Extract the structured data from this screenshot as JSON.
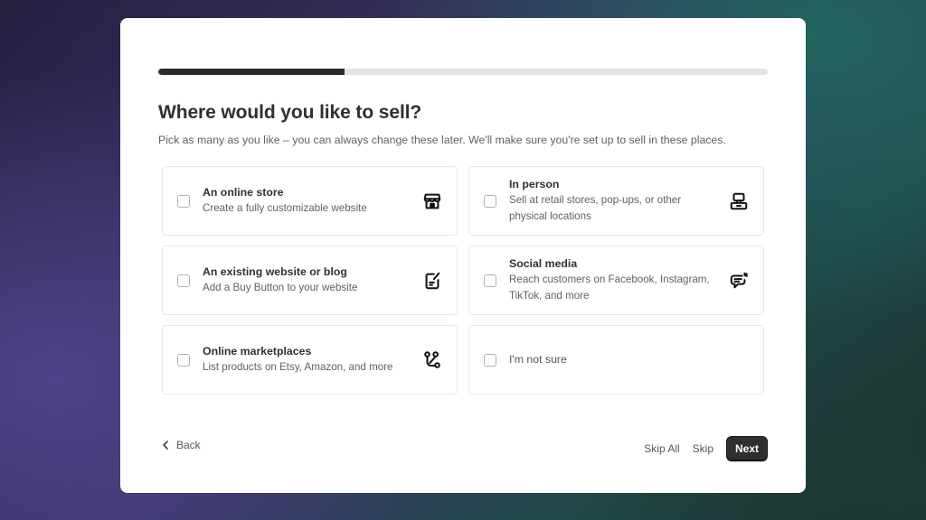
{
  "progress": {
    "fraction": 0.306
  },
  "header": {
    "title": "Where would you like to sell?",
    "subtitle": "Pick as many as you like – you can always change these later. We'll make sure you're set up to sell in these places."
  },
  "options": [
    {
      "label": "An online store",
      "description": "Create a fully customizable website",
      "icon": "storefront-icon",
      "checked": false
    },
    {
      "label": "In person",
      "description": "Sell at retail stores, pop-ups, or other physical locations",
      "icon": "point-of-sale-icon",
      "checked": false
    },
    {
      "label": "An existing website or blog",
      "description": "Add a Buy Button to your website",
      "icon": "edit-document-icon",
      "checked": false
    },
    {
      "label": "Social media",
      "description": "Reach customers on Facebook, Instagram, TikTok, and more",
      "icon": "chat-bubble-icon",
      "checked": false
    },
    {
      "label": "Online marketplaces",
      "description": "List products on Etsy, Amazon, and more",
      "icon": "connections-icon",
      "checked": false
    },
    {
      "label": "I'm not sure",
      "description": "",
      "icon": "",
      "checked": false
    }
  ],
  "footer": {
    "back_label": "Back",
    "skip_all_label": "Skip All",
    "skip_label": "Skip",
    "next_label": "Next"
  },
  "colors": {
    "progress_fill": "#2b2b2b",
    "progress_track": "#e3e3e3",
    "primary_button": "#2f2f2f"
  }
}
